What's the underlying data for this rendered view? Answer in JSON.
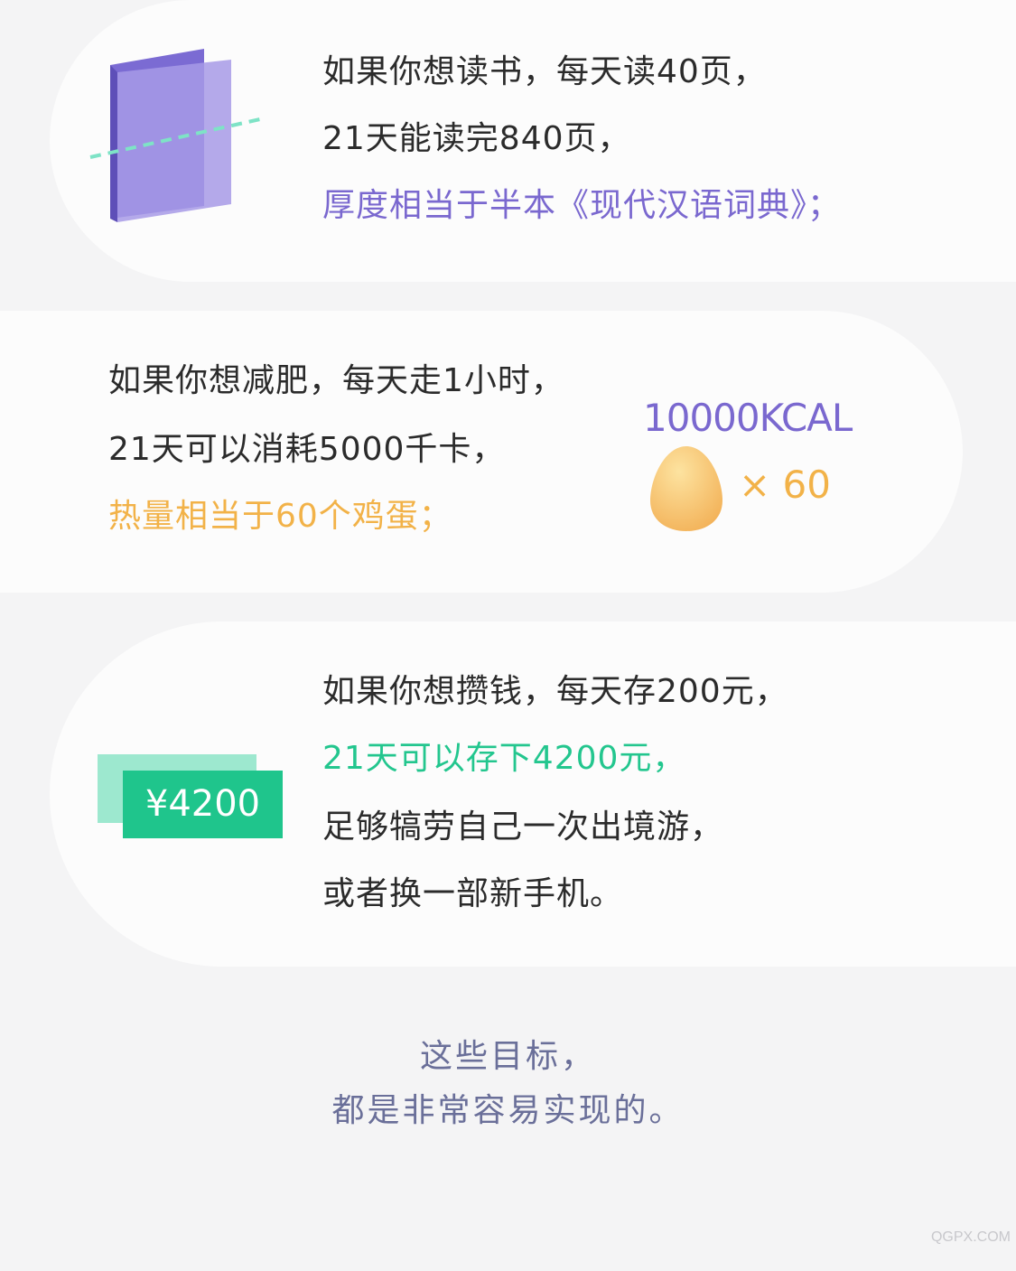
{
  "reading": {
    "line1": "如果你想读书，每天读40页，",
    "line2": "21天能读完840页，",
    "line3": "厚度相当于半本《现代汉语词典》；"
  },
  "diet": {
    "line1": "如果你想减肥，每天走1小时，",
    "line2": "21天可以消耗5000千卡，",
    "line3": "热量相当于60个鸡蛋；",
    "kcal_label": "10000KCAL",
    "times_label": "× 60"
  },
  "saving": {
    "line1": "如果你想攒钱，每天存200元，",
    "line2": "21天可以存下4200元，",
    "line3": "足够犒劳自己一次出境游，",
    "line4": "或者换一部新手机。",
    "badge": "¥4200"
  },
  "closing": {
    "line1": "这些目标，",
    "line2": "都是非常容易实现的。"
  },
  "watermark": "QGPX.COM",
  "icons": [
    "book-icon",
    "egg-icon",
    "money-badge"
  ],
  "colors": {
    "purple": "#7a68cf",
    "orange": "#f2b248",
    "green": "#23c68e",
    "closing": "#6a6f99"
  }
}
